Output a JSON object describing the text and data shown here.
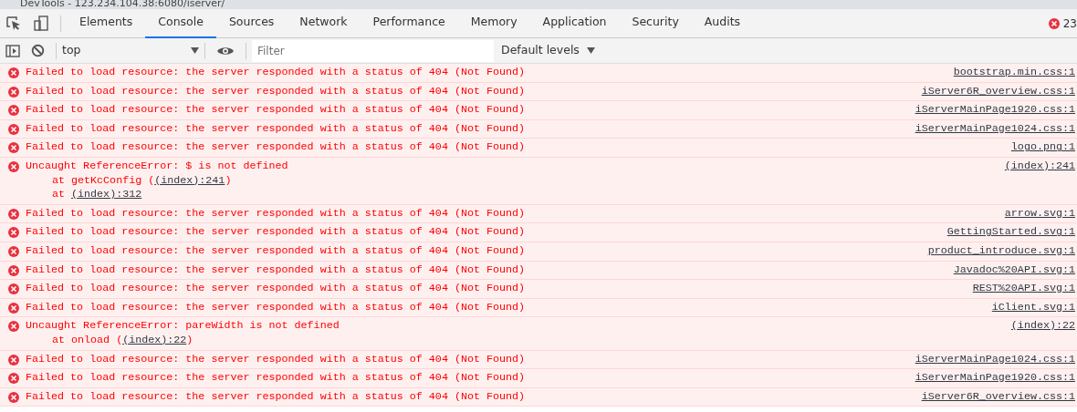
{
  "window": {
    "title": "DevTools - 123.234.104.38:6080/iserver/"
  },
  "tabs": [
    {
      "label": "Elements",
      "selected": false
    },
    {
      "label": "Console",
      "selected": true
    },
    {
      "label": "Sources",
      "selected": false
    },
    {
      "label": "Network",
      "selected": false
    },
    {
      "label": "Performance",
      "selected": false
    },
    {
      "label": "Memory",
      "selected": false
    },
    {
      "label": "Application",
      "selected": false
    },
    {
      "label": "Security",
      "selected": false
    },
    {
      "label": "Audits",
      "selected": false
    }
  ],
  "error_count": "23",
  "toolbar": {
    "context": "top",
    "filter_placeholder": "Filter",
    "levels": "Default levels"
  },
  "messages": [
    {
      "text": "Failed to load resource: the server responded with a status of 404 (Not Found)",
      "source": "bootstrap.min.css:1"
    },
    {
      "text": "Failed to load resource: the server responded with a status of 404 (Not Found)",
      "source": "iServer6R_overview.css:1"
    },
    {
      "text": "Failed to load resource: the server responded with a status of 404 (Not Found)",
      "source": "iServerMainPage1920.css:1"
    },
    {
      "text": "Failed to load resource: the server responded with a status of 404 (Not Found)",
      "source": "iServerMainPage1024.css:1"
    },
    {
      "text": "Failed to load resource: the server responded with a status of 404 (Not Found)",
      "source": "logo.png:1"
    },
    {
      "text": "Uncaught ReferenceError: $ is not defined",
      "source": "(index):241",
      "stack": [
        {
          "prefix": "at getKcConfig (",
          "link": "(index):241",
          "suffix": ")"
        },
        {
          "prefix": "at ",
          "link": "(index):312"
        }
      ]
    },
    {
      "text": "Failed to load resource: the server responded with a status of 404 (Not Found)",
      "source": "arrow.svg:1"
    },
    {
      "text": "Failed to load resource: the server responded with a status of 404 (Not Found)",
      "source": "GettingStarted.svg:1"
    },
    {
      "text": "Failed to load resource: the server responded with a status of 404 (Not Found)",
      "source": "product_introduce.svg:1"
    },
    {
      "text": "Failed to load resource: the server responded with a status of 404 (Not Found)",
      "source": "Javadoc%20API.svg:1"
    },
    {
      "text": "Failed to load resource: the server responded with a status of 404 (Not Found)",
      "source": "REST%20API.svg:1"
    },
    {
      "text": "Failed to load resource: the server responded with a status of 404 (Not Found)",
      "source": "iClient.svg:1"
    },
    {
      "text": "Uncaught ReferenceError: pareWidth is not defined",
      "source": "(index):22",
      "stack": [
        {
          "prefix": "at onload (",
          "link": "(index):22",
          "suffix": ")"
        }
      ]
    },
    {
      "text": "Failed to load resource: the server responded with a status of 404 (Not Found)",
      "source": "iServerMainPage1024.css:1"
    },
    {
      "text": "Failed to load resource: the server responded with a status of 404 (Not Found)",
      "source": "iServerMainPage1920.css:1"
    },
    {
      "text": "Failed to load resource: the server responded with a status of 404 (Not Found)",
      "source": "iServer6R_overview.css:1"
    }
  ]
}
